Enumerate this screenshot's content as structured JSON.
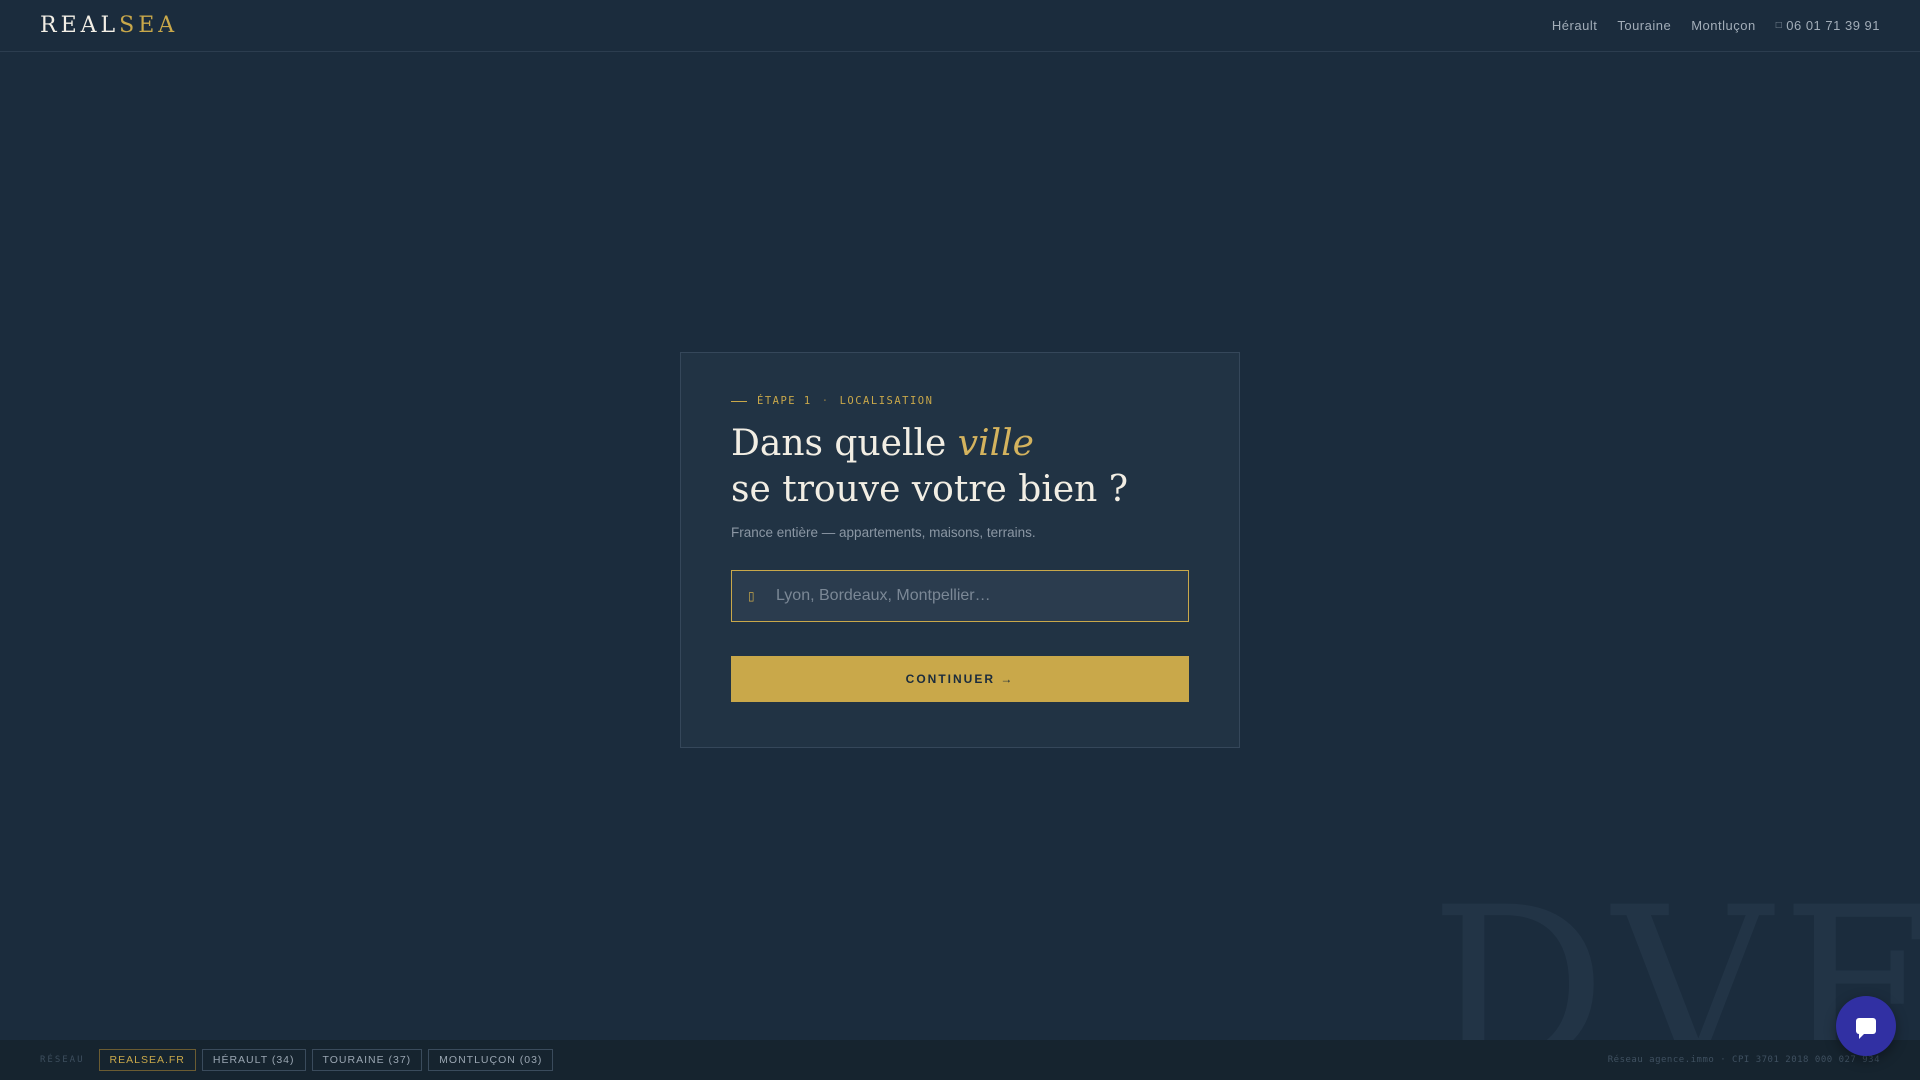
{
  "header": {
    "logo_part1": "REAL",
    "logo_part2": "SEA",
    "nav": [
      "Hérault",
      "Touraine",
      "Montluçon"
    ],
    "phone_icon": "phone-icon",
    "phone": "06 01 71 39 91"
  },
  "watermark": "DVF",
  "card": {
    "eyebrow_step": "ÉTAPE 1",
    "eyebrow_separator": "·",
    "eyebrow_label": "LOCALISATION",
    "title_line1_start": "Dans quelle ",
    "title_line1_italic": "ville",
    "title_line2": "se trouve votre bien ?",
    "subtitle": "France entière — appartements, maisons, terrains.",
    "search": {
      "icon": "map-pin-icon",
      "placeholder": "Lyon, Bordeaux, Montpellier…",
      "value": ""
    },
    "continue_label": "CONTINUER →"
  },
  "footer": {
    "network_label": "RÉSEAU",
    "chips": [
      "REALSEA.FR",
      "HÉRAULT (34)",
      "TOURAINE (37)",
      "MONTLUÇON (03)"
    ],
    "legal": "Réseau agence.immo · CPI 3701 2018 000 027 934"
  },
  "colors": {
    "background": "#1b2c3d",
    "accent": "#c9a84a",
    "card": "#213344",
    "chat": "#3130a3"
  }
}
